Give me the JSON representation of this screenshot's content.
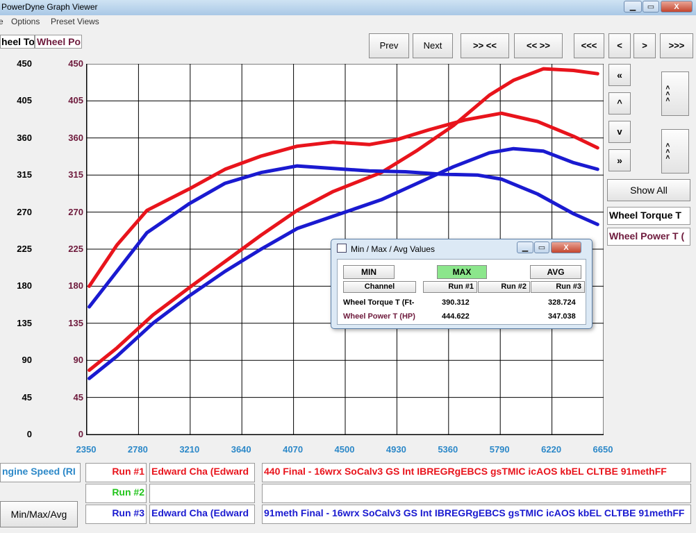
{
  "window": {
    "title": "PowerDyne Graph Viewer",
    "min": "▁",
    "max": "▭",
    "close": "X"
  },
  "menu": {
    "item1": "e",
    "options": "Options",
    "preset_views": "Preset Views"
  },
  "header": {
    "left_channel": "heel To",
    "right_channel": "Wheel Po"
  },
  "toolbar": {
    "prev": "Prev",
    "next": "Next",
    "zoom_in": ">> <<",
    "zoom_out": "<< >>",
    "first": "<<<",
    "back": "<",
    "forward": ">",
    "last": ">>>"
  },
  "side": {
    "up_fast": "«",
    "up": "^",
    "down": "v",
    "down_fast": "»",
    "scroll_up": "< < <",
    "scroll_down": "< < <",
    "show_all": "Show All",
    "legend_torque": "Wheel Torque T",
    "legend_power": "Wheel Power T ("
  },
  "colors": {
    "run1": "#e8141c",
    "run3": "#1a1ad0",
    "torque_label": "#000000",
    "power_label": "#6e1a3c",
    "run2": "#22c41c",
    "accent_x": "#2c88c8",
    "max_active": "#8ce68c"
  },
  "bottom": {
    "x_channel": "ngine Speed (RI",
    "minmax_button": "Min/Max/Avg",
    "runs": [
      {
        "label": "Run #1",
        "driver": "Edward Cha (Edward",
        "file": "440 Final - 16wrx SoCalv3 GS Int IBREGRgEBCS gsTMIC icAOS kbEL CLTBE 91methFF"
      },
      {
        "label": "Run #2",
        "driver": "",
        "file": ""
      },
      {
        "label": "Run #3",
        "driver": "Edward Cha (Edward",
        "file": "91meth Final - 16wrx SoCalv3 GS Int IBREGRgEBCS gsTMIC icAOS kbEL CLTBE 91methFF"
      }
    ]
  },
  "dialog": {
    "title": "Min / Max / Avg Values",
    "min": "MIN",
    "max": "MAX",
    "avg": "AVG",
    "col_channel": "Channel",
    "col_run1": "Run #1",
    "col_run2": "Run #2",
    "col_run3": "Run #3",
    "row1": {
      "name": "Wheel Torque T (Ft-",
      "run1": "390.312",
      "run2": "",
      "run3": "328.724"
    },
    "row2": {
      "name": "Wheel Power T (HP)",
      "run1": "444.622",
      "run2": "",
      "run3": "347.038"
    }
  },
  "chart_data": {
    "type": "line",
    "xlim": [
      2350,
      6650
    ],
    "ylim": [
      0,
      450
    ],
    "x_ticks": [
      "2350",
      "2780",
      "3210",
      "3640",
      "4070",
      "4500",
      "4930",
      "5360",
      "5790",
      "6220",
      "6650"
    ],
    "y_ticks": [
      "450",
      "405",
      "360",
      "315",
      "270",
      "225",
      "180",
      "135",
      "90",
      "45",
      "0"
    ],
    "grid": true,
    "series": [
      {
        "name": "Run #1 Wheel Torque",
        "color": "#e8141c",
        "x": [
          2370,
          2600,
          2850,
          3200,
          3500,
          3800,
          4100,
          4400,
          4700,
          4930,
          5200,
          5500,
          5800,
          6100,
          6400,
          6600
        ],
        "y": [
          180,
          230,
          272,
          298,
          322,
          338,
          350,
          355,
          352,
          358,
          370,
          382,
          390,
          380,
          362,
          348
        ]
      },
      {
        "name": "Run #1 Wheel Power",
        "color": "#e8141c",
        "x": [
          2370,
          2600,
          2900,
          3200,
          3500,
          3800,
          4100,
          4400,
          4800,
          5100,
          5400,
          5700,
          5900,
          6150,
          6400,
          6600
        ],
        "y": [
          78,
          105,
          145,
          178,
          210,
          242,
          272,
          295,
          318,
          345,
          375,
          412,
          430,
          444,
          442,
          438
        ]
      },
      {
        "name": "Run #3 Wheel Torque",
        "color": "#1a1ad0",
        "x": [
          2370,
          2600,
          2850,
          3200,
          3500,
          3800,
          4100,
          4400,
          4700,
          5000,
          5300,
          5600,
          5800,
          6100,
          6400,
          6600
        ],
        "y": [
          155,
          198,
          245,
          280,
          305,
          318,
          326,
          323,
          320,
          319,
          316,
          315,
          310,
          292,
          268,
          255
        ]
      },
      {
        "name": "Run #3 Wheel Power",
        "color": "#1a1ad0",
        "x": [
          2370,
          2600,
          2900,
          3200,
          3500,
          3800,
          4100,
          4400,
          4800,
          5100,
          5400,
          5700,
          5900,
          6150,
          6400,
          6600
        ],
        "y": [
          68,
          95,
          135,
          168,
          198,
          225,
          250,
          265,
          285,
          305,
          325,
          342,
          347,
          344,
          330,
          322
        ]
      }
    ]
  }
}
